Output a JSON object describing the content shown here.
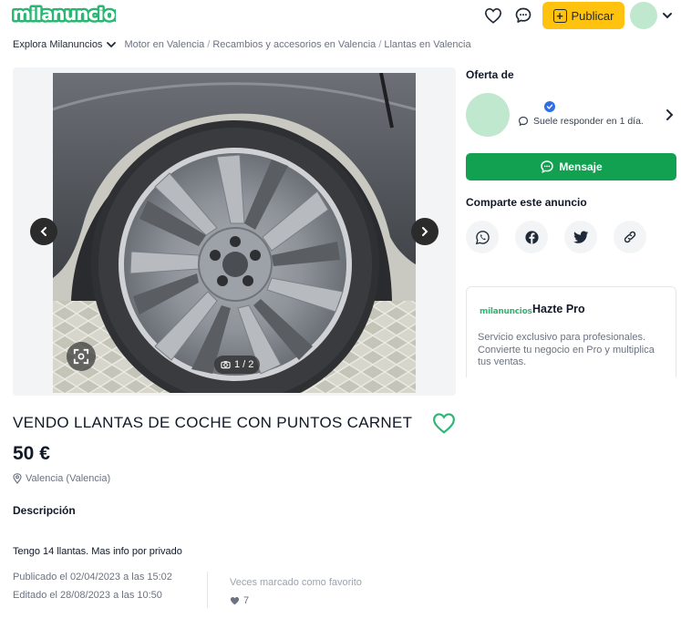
{
  "header": {
    "logo": "milanuncios",
    "publish_label": "Publicar",
    "icons": [
      "heart-icon",
      "chat-icon",
      "plus-square-icon",
      "chevron-down-icon"
    ]
  },
  "breadcrumb": {
    "explore": "Explora Milanuncios",
    "items": [
      "Motor en Valencia",
      "Recambios y accesorios en Valencia",
      "Llantas en Valencia"
    ]
  },
  "gallery": {
    "counter": "1 / 2",
    "current": 1,
    "total": 2
  },
  "listing": {
    "title": "VENDO LLANTAS DE COCHE CON PUNTOS CARNET",
    "price": "50 €",
    "location": "Valencia (Valencia)",
    "description_heading": "Descripción",
    "description": "Tengo 14 llantas. Mas info por privado",
    "published": "Publicado el 02/04/2023 a las 15:02",
    "edited": "Editado el 28/08/2023 a las 10:50",
    "favorites_label": "Veces marcado como favorito",
    "favorites_count": "7"
  },
  "seller": {
    "offer_label": "Oferta de",
    "response_time": "Suele responder en 1 día.",
    "message_button": "Mensaje"
  },
  "share": {
    "label": "Comparte este anuncio",
    "buttons": [
      "whatsapp-icon",
      "facebook-icon",
      "twitter-icon",
      "link-icon"
    ]
  },
  "pro": {
    "logo": "milanuncios",
    "title": "Hazte Pro",
    "text": "Servicio exclusivo para profesionales. Convierte tu negocio en Pro y multiplica tus ventas."
  },
  "colors": {
    "brand_green": "#2bb673",
    "message_green": "#12a150",
    "publish_yellow": "#ffc20e",
    "avatar_mint": "#bfe8cf"
  }
}
